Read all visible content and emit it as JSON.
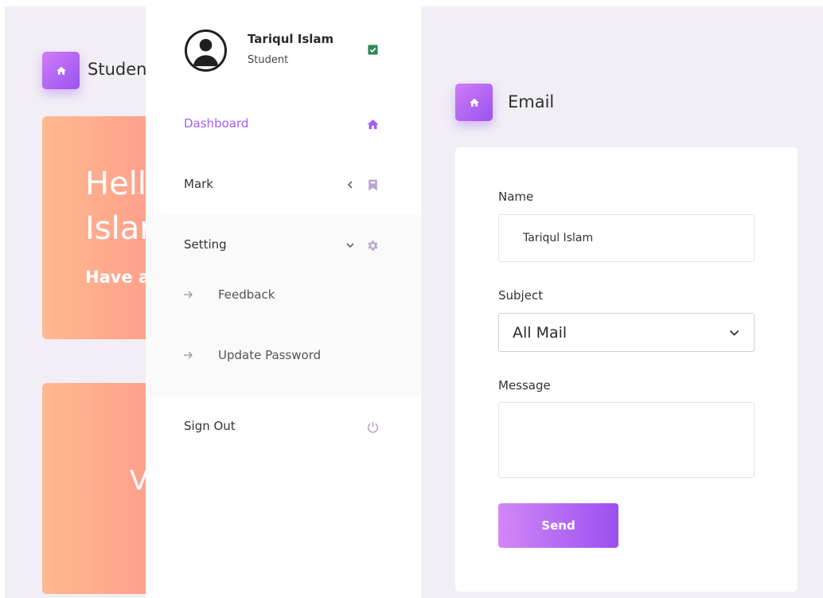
{
  "background_page": {
    "title": "Studen",
    "hero": {
      "line1": "Hell",
      "line2": "Islar",
      "line3": "Have a"
    },
    "card2_text": "V"
  },
  "sidebar": {
    "user": {
      "name": "Tariqul Islam",
      "role": "Student"
    },
    "items": [
      {
        "label": "Dashboard",
        "icon": "home-icon",
        "active": true
      },
      {
        "label": "Mark",
        "icon": "bookmark-icon"
      },
      {
        "label": "Setting",
        "icon": "gear-icon",
        "expanded": true,
        "children": [
          {
            "label": "Feedback"
          },
          {
            "label": "Update Password"
          }
        ]
      },
      {
        "label": "Sign Out",
        "icon": "power-icon"
      }
    ]
  },
  "email": {
    "title": "Email",
    "name_label": "Name",
    "name_value": "Tariqul Islam",
    "subject_label": "Subject",
    "subject_value": "All Mail",
    "message_label": "Message",
    "message_value": "",
    "send_label": "Send"
  },
  "colors": {
    "accent": "#a35ef2",
    "accent_gradient": [
      "#d287f7",
      "#9a50f0"
    ],
    "hero_gradient": [
      "#ffb990",
      "#ff9b8a"
    ],
    "panel_bg": "#f1eef5",
    "verified": "#2e8b57"
  }
}
